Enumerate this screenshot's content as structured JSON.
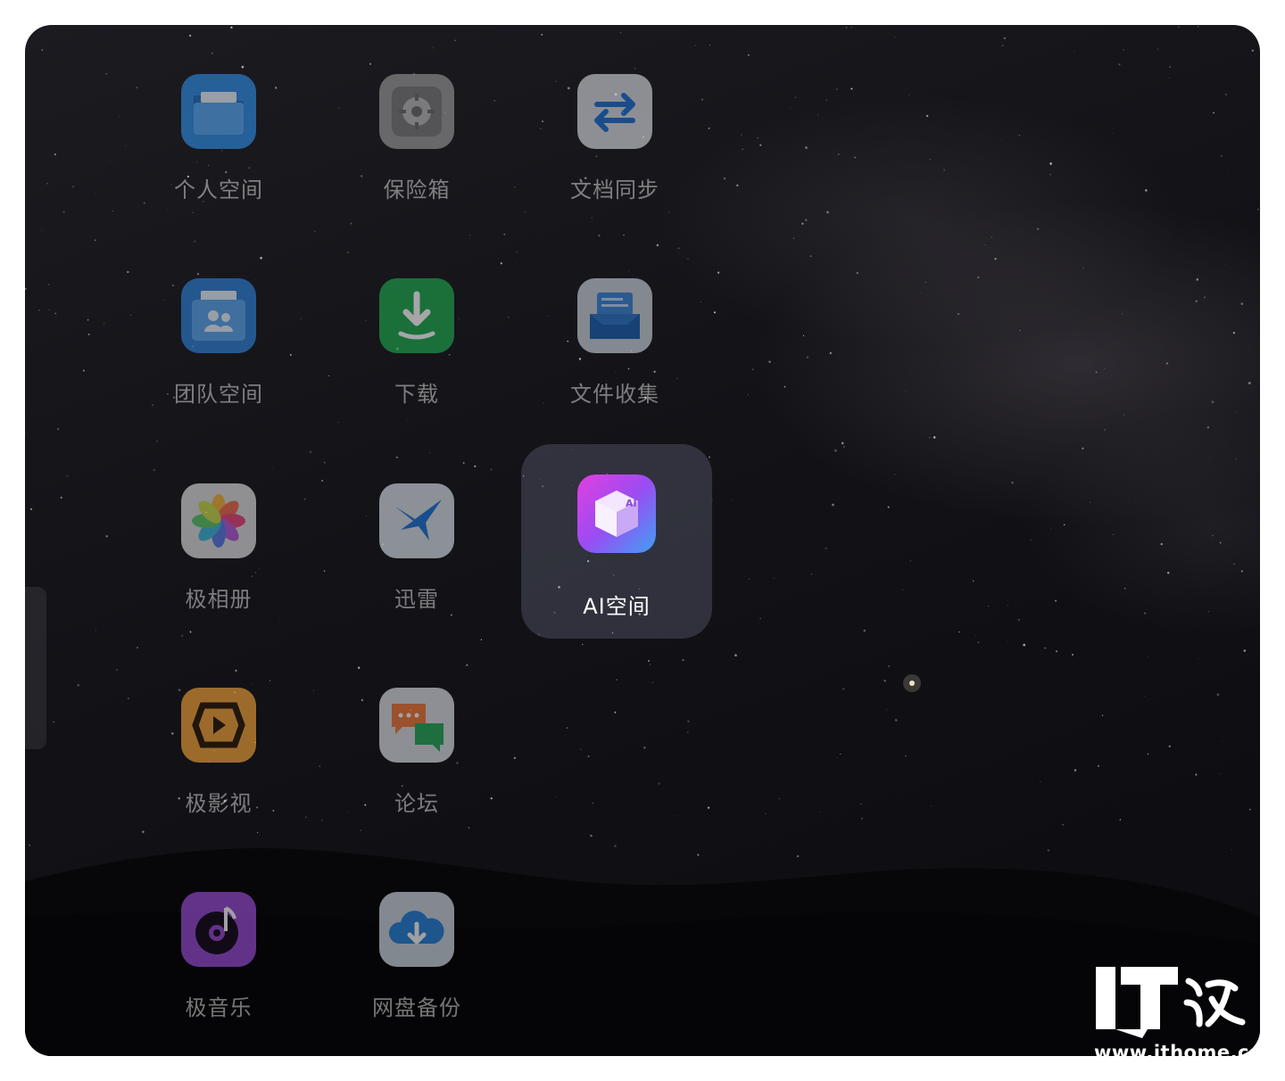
{
  "apps": [
    {
      "key": "personal",
      "label": "个人空间",
      "icon": "folder-icon",
      "active": false
    },
    {
      "key": "safe",
      "label": "保险箱",
      "icon": "safe-icon",
      "active": false
    },
    {
      "key": "sync",
      "label": "文档同步",
      "icon": "sync-arrows-icon",
      "active": false
    },
    {
      "key": "team",
      "label": "团队空间",
      "icon": "team-folder-icon",
      "active": false
    },
    {
      "key": "download",
      "label": "下载",
      "icon": "download-icon",
      "active": false
    },
    {
      "key": "collect",
      "label": "文件收集",
      "icon": "file-tray-icon",
      "active": false
    },
    {
      "key": "album",
      "label": "极相册",
      "icon": "photo-flower-icon",
      "active": false
    },
    {
      "key": "xunlei",
      "label": "迅雷",
      "icon": "hummingbird-icon",
      "active": false
    },
    {
      "key": "ai",
      "label": "AI空间",
      "icon": "ai-cube-icon",
      "active": true
    },
    {
      "key": "video",
      "label": "极影视",
      "icon": "film-play-icon",
      "active": false
    },
    {
      "key": "forum",
      "label": "论坛",
      "icon": "chat-bubbles-icon",
      "active": false
    },
    {
      "key": "music",
      "label": "极音乐",
      "icon": "music-disc-icon",
      "active": false
    },
    {
      "key": "backup",
      "label": "网盘备份",
      "icon": "cloud-download-icon",
      "active": false
    }
  ],
  "ai_icon_text": "AI",
  "watermark": {
    "url": "www.ithome.com",
    "logo": "IT之家"
  },
  "colors": {
    "accent_ai": "#c04cf0",
    "download_green": "#1fa84f",
    "folder_blue": "#2f8de4"
  }
}
